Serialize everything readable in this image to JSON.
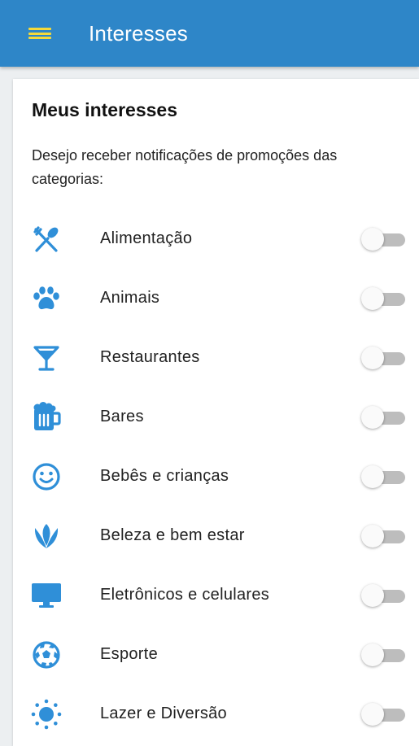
{
  "app_bar": {
    "title": "Interesses",
    "menu_icon": "menu-icon",
    "background_color": "#2e86c8",
    "menu_icon_color": "#f5d93a"
  },
  "card": {
    "title": "Meus interesses",
    "description": "Desejo receber notificações de promoções das categorias:"
  },
  "icon_color": "#2f8fd8",
  "categories": [
    {
      "label": "Alimentação",
      "icon": "fork-knife-icon",
      "enabled": false
    },
    {
      "label": "Animais",
      "icon": "paw-icon",
      "enabled": false
    },
    {
      "label": "Restaurantes",
      "icon": "cocktail-icon",
      "enabled": false
    },
    {
      "label": "Bares",
      "icon": "beer-mug-icon",
      "enabled": false
    },
    {
      "label": "Bebês e crianças",
      "icon": "smiley-icon",
      "enabled": false
    },
    {
      "label": "Beleza e bem estar",
      "icon": "flower-icon",
      "enabled": false
    },
    {
      "label": "Eletrônicos e celulares",
      "icon": "monitor-icon",
      "enabled": false
    },
    {
      "label": "Esporte",
      "icon": "soccer-ball-icon",
      "enabled": false
    },
    {
      "label": "Lazer e Diversão",
      "icon": "sun-icon",
      "enabled": false
    }
  ]
}
